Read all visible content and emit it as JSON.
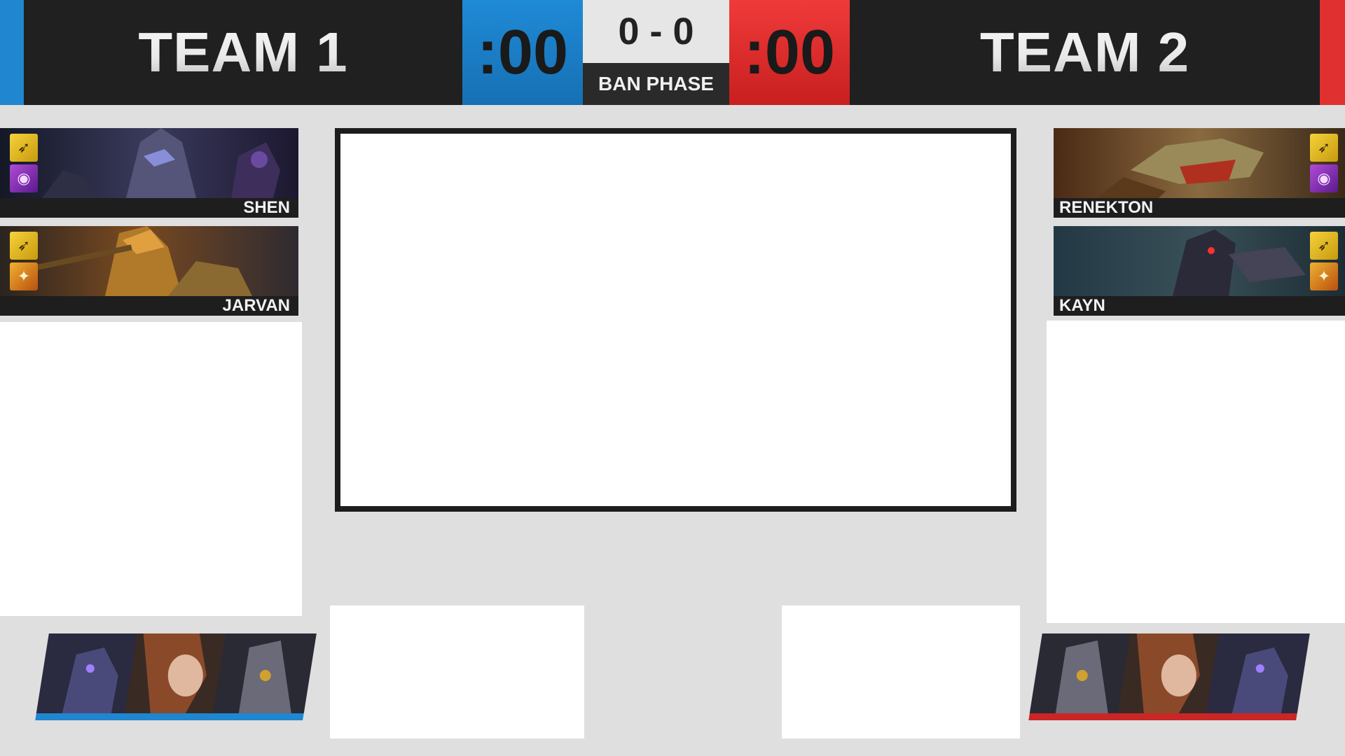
{
  "header": {
    "team1_name": "TEAM 1",
    "team2_name": "TEAM 2",
    "team1_timer": ":00",
    "team2_timer": ":00",
    "score": "0 - 0",
    "phase": "BAN PHASE",
    "colors": {
      "blue": "#1f86cf",
      "red": "#e03030",
      "dark": "#202020"
    }
  },
  "team1": {
    "picks": [
      {
        "champion": "SHEN",
        "spells": [
          "flash-icon",
          "teleport-icon"
        ]
      },
      {
        "champion": "JARVAN",
        "spells": [
          "flash-icon",
          "smite-icon"
        ]
      }
    ],
    "bans": [
      "ban-portrait-icon",
      "ban-portrait-icon",
      "ban-portrait-icon"
    ]
  },
  "team2": {
    "picks": [
      {
        "champion": "RENEKTON",
        "spells": [
          "flash-icon",
          "teleport-icon"
        ]
      },
      {
        "champion": "KAYN",
        "spells": [
          "flash-icon",
          "smite-icon"
        ]
      }
    ],
    "bans": [
      "ban-portrait-icon",
      "ban-portrait-icon",
      "ban-portrait-icon"
    ]
  }
}
